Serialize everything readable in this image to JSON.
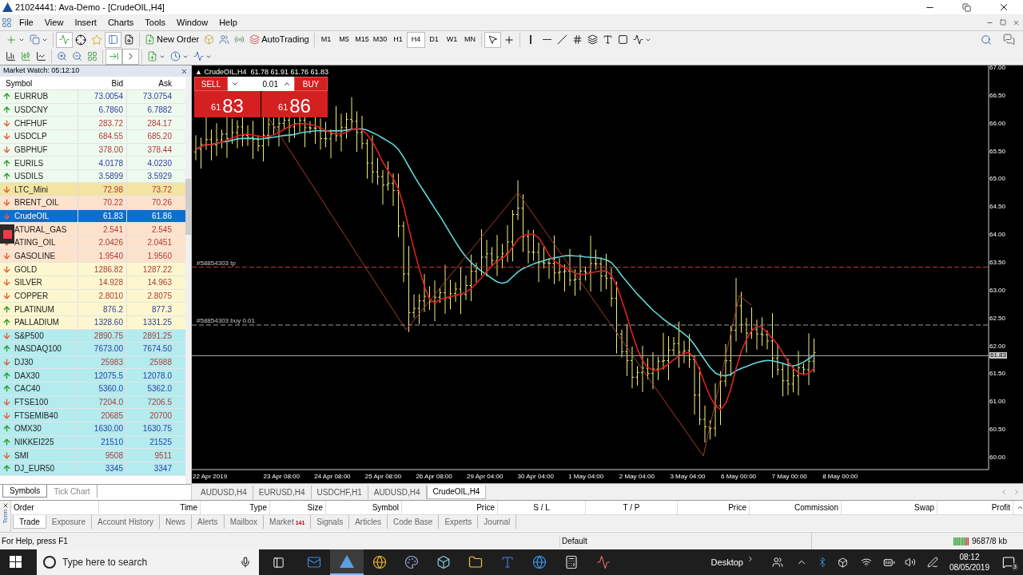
{
  "window": {
    "title": "21024441: Ava-Demo - [CrudeOIL,H4]"
  },
  "menu": [
    "File",
    "View",
    "Insert",
    "Charts",
    "Tools",
    "Window",
    "Help"
  ],
  "toolbar": {
    "new_order": "New Order",
    "auto_trading": "AutoTrading",
    "timeframes": [
      {
        "label": "M1",
        "selected": false
      },
      {
        "label": "M5",
        "selected": false
      },
      {
        "label": "M15",
        "selected": false
      },
      {
        "label": "M30",
        "selected": false
      },
      {
        "label": "H1",
        "selected": false
      },
      {
        "label": "H4",
        "selected": true
      },
      {
        "label": "D1",
        "selected": false
      },
      {
        "label": "W1",
        "selected": false
      },
      {
        "label": "MN",
        "selected": false
      }
    ]
  },
  "market_watch": {
    "title": "Market Watch: 05:12:10",
    "columns": [
      "Symbol",
      "Bid",
      "Ask"
    ],
    "rows": [
      {
        "symbol": "EURRUB",
        "bid": "73.0054",
        "ask": "73.0754",
        "rising": true,
        "color": "#effaee",
        "selected": false
      },
      {
        "symbol": "USDCNY",
        "bid": "6.7860",
        "ask": "6.7882",
        "rising": true,
        "color": "#effaee",
        "selected": false
      },
      {
        "symbol": "CHFHUF",
        "bid": "283.72",
        "ask": "284.17",
        "rising": false,
        "color": "#effaee",
        "selected": false
      },
      {
        "symbol": "USDCLP",
        "bid": "684.55",
        "ask": "685.20",
        "rising": false,
        "color": "#effaee",
        "selected": false
      },
      {
        "symbol": "GBPHUF",
        "bid": "378.00",
        "ask": "378.44",
        "rising": false,
        "color": "#effaee",
        "selected": false
      },
      {
        "symbol": "EURILS",
        "bid": "4.0178",
        "ask": "4.0230",
        "rising": true,
        "color": "#effaee",
        "selected": false
      },
      {
        "symbol": "USDILS",
        "bid": "3.5899",
        "ask": "3.5929",
        "rising": true,
        "color": "#effaee",
        "selected": false
      },
      {
        "symbol": "LTC_Mini",
        "bid": "72.98",
        "ask": "73.72",
        "rising": false,
        "color": "#f3e4a2",
        "selected": false
      },
      {
        "symbol": "BRENT_OIL",
        "bid": "70.22",
        "ask": "70.26",
        "rising": false,
        "color": "#fde2cc",
        "selected": false
      },
      {
        "symbol": "CrudeOIL",
        "bid": "61.83",
        "ask": "61.86",
        "rising": false,
        "selected": true
      },
      {
        "symbol": "ATURAL_GAS",
        "bid": "2.541",
        "ask": "2.545",
        "rising": false,
        "color": "#fde2cc",
        "selected": false
      },
      {
        "symbol": "ATING_OIL",
        "bid": "2.0426",
        "ask": "2.0451",
        "rising": false,
        "color": "#fde2cc",
        "selected": false
      },
      {
        "symbol": "GASOLINE",
        "bid": "1.9540",
        "ask": "1.9560",
        "rising": false,
        "color": "#fde2cc",
        "selected": false
      },
      {
        "symbol": "GOLD",
        "bid": "1286.82",
        "ask": "1287.22",
        "rising": false,
        "color": "#fdf7cf",
        "selected": false
      },
      {
        "symbol": "SILVER",
        "bid": "14.928",
        "ask": "14.963",
        "rising": false,
        "color": "#fdf7cf",
        "selected": false
      },
      {
        "symbol": "COPPER",
        "bid": "2.8010",
        "ask": "2.8075",
        "rising": false,
        "color": "#fdf7cf",
        "selected": false
      },
      {
        "symbol": "PLATINUM",
        "bid": "876.2",
        "ask": "877.3",
        "rising": true,
        "color": "#fdf7cf",
        "selected": false
      },
      {
        "symbol": "PALLADIUM",
        "bid": "1328.60",
        "ask": "1331.25",
        "rising": true,
        "color": "#fdf7cf",
        "selected": false
      },
      {
        "symbol": "S&P500",
        "bid": "2890.75",
        "ask": "2891.25",
        "rising": false,
        "color": "#b3ebee",
        "selected": false
      },
      {
        "symbol": "NASDAQ100",
        "bid": "7673.00",
        "ask": "7674.50",
        "rising": true,
        "color": "#b3ebee",
        "selected": false
      },
      {
        "symbol": "DJ30",
        "bid": "25983",
        "ask": "25988",
        "rising": false,
        "color": "#b3ebee",
        "selected": false
      },
      {
        "symbol": "DAX30",
        "bid": "12075.5",
        "ask": "12078.0",
        "rising": true,
        "color": "#b3ebee",
        "selected": false
      },
      {
        "symbol": "CAC40",
        "bid": "5360.0",
        "ask": "5362.0",
        "rising": true,
        "color": "#b3ebee",
        "selected": false
      },
      {
        "symbol": "FTSE100",
        "bid": "7204.0",
        "ask": "7206.5",
        "rising": false,
        "color": "#b3ebee",
        "selected": false
      },
      {
        "symbol": "FTSEMIB40",
        "bid": "20685",
        "ask": "20700",
        "rising": false,
        "color": "#b3ebee",
        "selected": false
      },
      {
        "symbol": "OMX30",
        "bid": "1630.00",
        "ask": "1630.75",
        "rising": true,
        "color": "#b3ebee",
        "selected": false
      },
      {
        "symbol": "NIKKEI225",
        "bid": "21510",
        "ask": "21525",
        "rising": true,
        "color": "#b3ebee",
        "selected": false
      },
      {
        "symbol": "SMI",
        "bid": "9508",
        "ask": "9511",
        "rising": false,
        "color": "#b3ebee",
        "selected": false
      },
      {
        "symbol": "DJ_EUR50",
        "bid": "3345",
        "ask": "3347",
        "rising": true,
        "color": "#b3ebee",
        "selected": false
      }
    ],
    "tabs": [
      {
        "label": "Symbols",
        "selected": true
      },
      {
        "label": "Tick Chart",
        "selected": false
      }
    ]
  },
  "chart": {
    "header": "▲ CrudeOIL,H4  61.78 61.91 61.76 61.83",
    "trade_panel": {
      "sell": "SELL",
      "buy": "BUY",
      "volume": "0.01",
      "sell_big": "61",
      "sell_small": "83",
      "buy_big": "61",
      "buy_small": "86"
    },
    "order_lines": [
      {
        "label": "#58854303 tp",
        "kind": "tp"
      },
      {
        "label": "#58854303 buy 0.01",
        "kind": "entry"
      }
    ],
    "current_price": "61.83",
    "price_labels": [
      "67.00",
      "66.50",
      "66.00",
      "65.50",
      "65.00",
      "64.50",
      "64.00",
      "63.50",
      "63.00",
      "62.50",
      "62.00",
      "61.50",
      "61.00",
      "60.50",
      "60.00"
    ],
    "time_labels": [
      "22 Apr 2019",
      "23 Apr 08:00",
      "24 Apr 08:00",
      "25 Apr 08:00",
      "26 Apr 08:00",
      "29 Apr 04:00",
      "30 Apr 04:00",
      "1 May 04:00",
      "2 May 04:00",
      "3 May 04:00",
      "6 May 00:00",
      "7 May 00:00",
      "8 May 00:00"
    ],
    "tabs": [
      {
        "label": "AUDUSD,H4",
        "selected": false
      },
      {
        "label": "EURUSD,H4",
        "selected": false
      },
      {
        "label": "USDCHF,H1",
        "selected": false
      },
      {
        "label": "AUDUSD,H4",
        "selected": false
      },
      {
        "label": "CrudeOIL,H4",
        "selected": true
      }
    ]
  },
  "terminal": {
    "side_label": "Term",
    "columns": [
      "Order",
      "Time",
      "Type",
      "Size",
      "Symbol",
      "Price",
      "S / L",
      "T / P",
      "Price",
      "Commission",
      "Swap",
      "Profit"
    ],
    "tabs": [
      {
        "label": "Trade",
        "selected": true
      },
      {
        "label": "Exposure",
        "selected": false
      },
      {
        "label": "Account History",
        "selected": false
      },
      {
        "label": "News",
        "selected": false
      },
      {
        "label": "Alerts",
        "selected": false
      },
      {
        "label": "Mailbox",
        "selected": false
      },
      {
        "label": "Market",
        "selected": false,
        "badge": "141"
      },
      {
        "label": "Signals",
        "selected": false
      },
      {
        "label": "Articles",
        "selected": false
      },
      {
        "label": "Code Base",
        "selected": false
      },
      {
        "label": "Experts",
        "selected": false
      },
      {
        "label": "Journal",
        "selected": false
      }
    ]
  },
  "status_bar": {
    "help": "For Help, press F1",
    "profile": "Default",
    "traffic": "9687/8 kb"
  },
  "taskbar": {
    "search_placeholder": "Type here to search",
    "desktop": "Desktop",
    "time": "08:12",
    "date": "08/05/2019",
    "notifications": "3"
  }
}
